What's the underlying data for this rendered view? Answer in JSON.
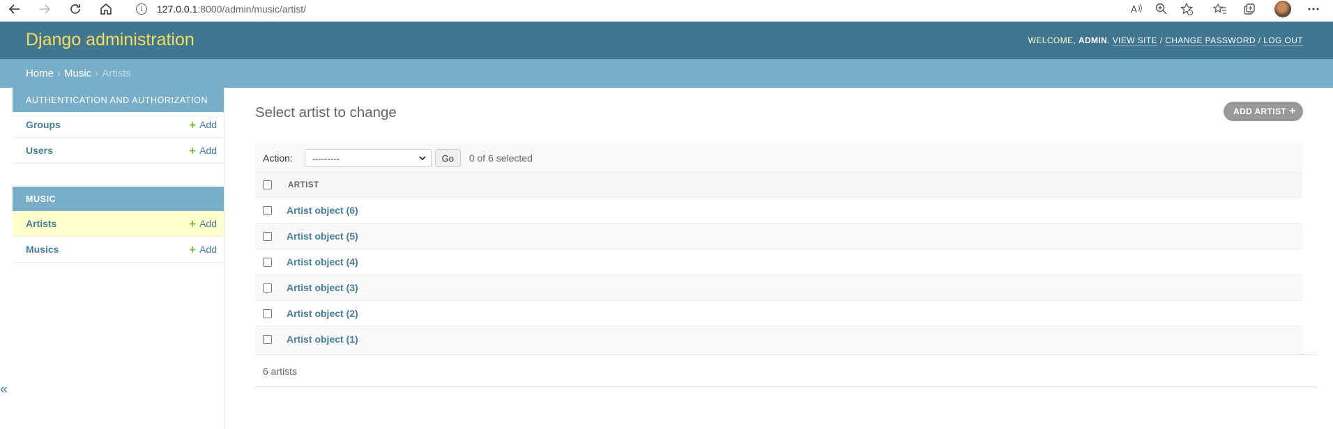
{
  "browser": {
    "url_host": "127.0.0.1",
    "url_rest": ":8000/admin/music/artist/"
  },
  "header": {
    "branding": "Django administration",
    "welcome": "Welcome, ",
    "username": "admin",
    "view_site": "View site",
    "change_password": "Change password",
    "log_out": "Log out",
    "sep1": ". ",
    "sep2": " / ",
    "sep3": " / "
  },
  "breadcrumbs": {
    "home": "Home",
    "app": "Music",
    "current": "Artists",
    "separator": "›"
  },
  "sidebar": {
    "modules": [
      {
        "caption": "Authentication and Authorization",
        "models": [
          {
            "name": "Groups",
            "add": "Add"
          },
          {
            "name": "Users",
            "add": "Add"
          }
        ]
      },
      {
        "caption": "Music",
        "models": [
          {
            "name": "Artists",
            "add": "Add"
          },
          {
            "name": "Musics",
            "add": "Add"
          }
        ]
      }
    ],
    "collapse_glyph": "«"
  },
  "content": {
    "title": "Select artist to change",
    "add_button": "Add artist",
    "action_label": "Action:",
    "action_selected": "---------",
    "go_button": "Go",
    "selected_count": "0 of 6 selected",
    "column_header": "Artist",
    "rows": [
      "Artist object (6)",
      "Artist object (5)",
      "Artist object (4)",
      "Artist object (3)",
      "Artist object (2)",
      "Artist object (1)"
    ],
    "paginator": "6 artists"
  },
  "colors": {
    "header_bg": "#417690",
    "branding": "#f5dd5d",
    "breadcrumbs_bg": "#79aec8",
    "link": "#447e9b",
    "add_green": "#70bf2b",
    "current_row": "#ffffcc"
  },
  "icons": {
    "back": "arrow-left-icon",
    "forward": "arrow-right-icon",
    "refresh": "refresh-icon",
    "home": "home-icon",
    "info": "info-icon",
    "read_aloud": "read-aloud-icon",
    "zoom": "zoom-icon",
    "favorite_add": "star-add-icon",
    "favorites": "favorites-icon",
    "collections": "collections-icon",
    "more": "more-icon"
  }
}
